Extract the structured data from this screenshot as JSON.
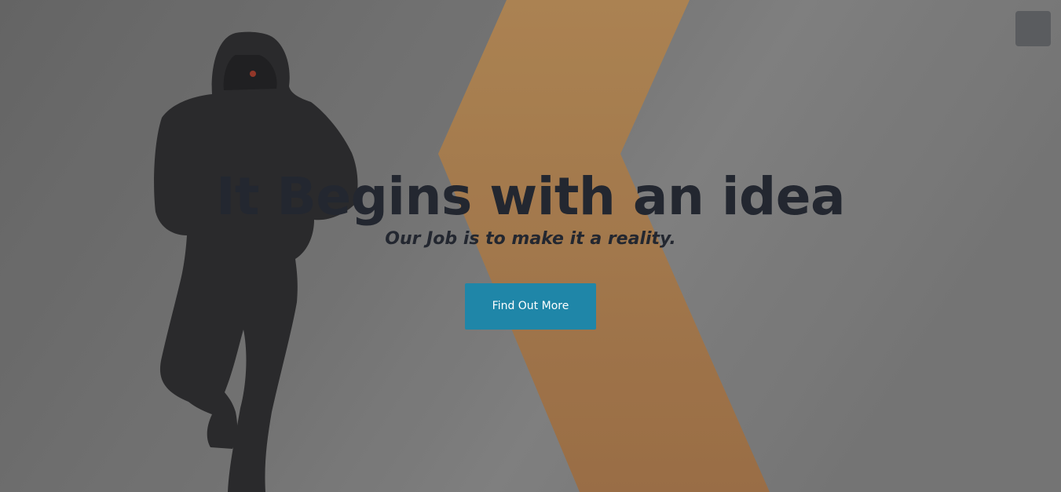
{
  "hero": {
    "headline": "It Begins with an idea",
    "subheadline": "Our Job is to make it a reality.",
    "cta_label": "Find Out More"
  },
  "nav": {
    "menu_toggle_icon": "menu-toggle-icon"
  },
  "colors": {
    "accent": "#1f86a8",
    "heading_text": "#232730",
    "stripe": "#b98a55",
    "menu_button": "#5a5c5f"
  }
}
